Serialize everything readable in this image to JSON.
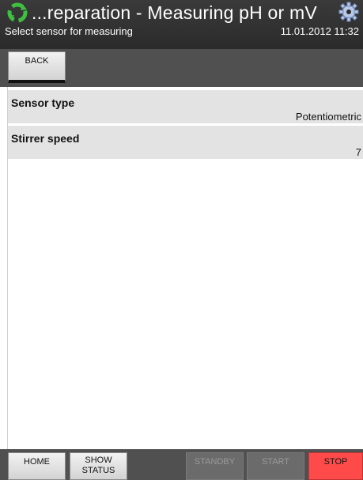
{
  "header": {
    "title": "...reparation - Measuring pH or mV",
    "subtitle": "Select sensor for measuring",
    "datetime": "11.01.2012 11:32",
    "app_icon": "recycle-icon",
    "settings_icon": "gear-icon"
  },
  "toolbar": {
    "back_label": "BACK"
  },
  "fields": [
    {
      "label": "Sensor type",
      "value": "Potentiometric"
    },
    {
      "label": "Stirrer speed",
      "value": "7"
    }
  ],
  "footer": {
    "home_label": "HOME",
    "status_label_line1": "SHOW",
    "status_label_line2": "STATUS",
    "standby_label": "STANDBY",
    "start_label": "START",
    "stop_label": "STOP"
  },
  "colors": {
    "header_bg": "#2b2b2b",
    "toolbar_bg": "#505050",
    "field_bg": "#e3e3e3",
    "stop_bg": "#ff4a4a"
  }
}
